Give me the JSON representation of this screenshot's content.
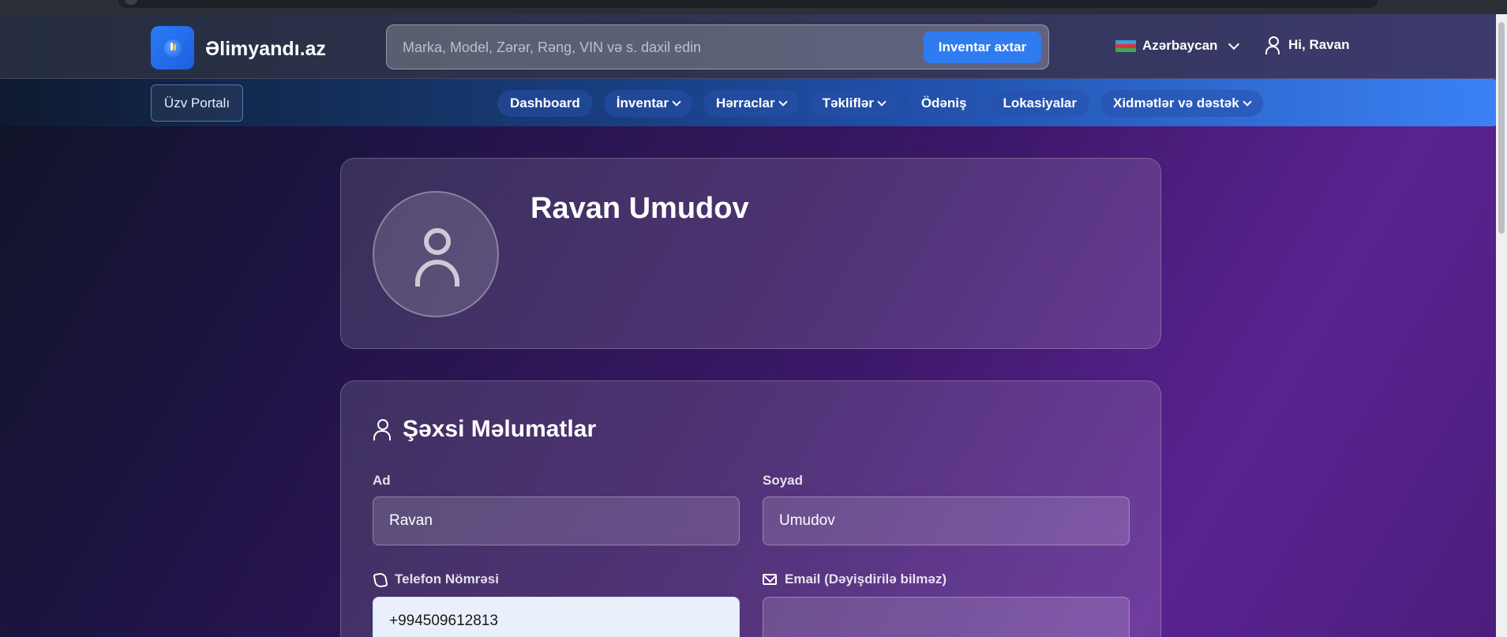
{
  "header": {
    "brand": "Əlimyandı.az",
    "search_placeholder": "Marka, Model, Zərər, Rəng, VIN və s. daxil edin",
    "search_button": "Inventar axtar",
    "language": "Azərbaycan",
    "greeting": "Hi, Ravan"
  },
  "nav": {
    "member_portal": "Üzv Portalı",
    "items": [
      {
        "label": "Dashboard",
        "dropdown": false
      },
      {
        "label": "İnventar",
        "dropdown": true
      },
      {
        "label": "Hərraclar",
        "dropdown": true
      },
      {
        "label": "Təkliflər",
        "dropdown": true
      },
      {
        "label": "Ödəniş",
        "dropdown": false
      },
      {
        "label": "Lokasiyalar",
        "dropdown": false
      },
      {
        "label": "Xidmətlər və dəstək",
        "dropdown": true
      }
    ]
  },
  "profile": {
    "name": "Ravan Umudov"
  },
  "personal": {
    "title": "Şəxsi Məlumatlar",
    "first_name_label": "Ad",
    "first_name_value": "Ravan",
    "last_name_label": "Soyad",
    "last_name_value": "Umudov",
    "phone_label": "Telefon Nömrəsi",
    "phone_value": "+994509612813",
    "email_label": "Email (Dəyişdirilə bilməz)",
    "email_value": ""
  }
}
